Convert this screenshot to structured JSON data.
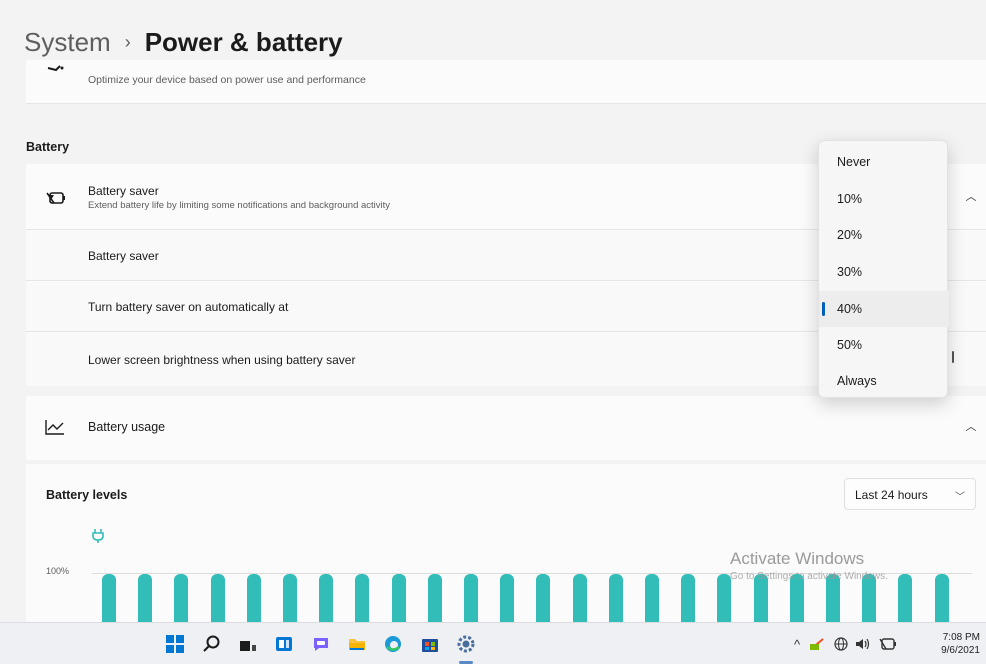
{
  "breadcrumb": {
    "parent": "System",
    "separator": "›",
    "current": "Power & battery"
  },
  "power_mode": {
    "description": "Optimize your device based on power use and performance"
  },
  "battery_section": {
    "label": "Battery"
  },
  "battery_saver": {
    "title": "Battery saver",
    "subtitle": "Extend battery life by limiting some notifications and background activity",
    "rows": [
      {
        "label": "Battery saver"
      },
      {
        "label": "Turn battery saver on automatically at"
      },
      {
        "label": "Lower screen brightness when using battery saver"
      }
    ]
  },
  "threshold_dropdown": {
    "options": [
      "Never",
      "10%",
      "20%",
      "30%",
      "40%",
      "50%",
      "Always"
    ],
    "selected": "40%"
  },
  "battery_usage": {
    "title": "Battery usage"
  },
  "battery_levels": {
    "title": "Battery levels",
    "range": "Last 24 hours",
    "axis_label": "100%",
    "bar_count": 24
  },
  "watermark": {
    "line1": "Activate Windows",
    "line2": "Go to Settings to activate Windows."
  },
  "taskbar": {
    "apps": [
      "windows-start",
      "search",
      "task-view",
      "widgets",
      "chat",
      "file-explorer",
      "edge",
      "store",
      "settings"
    ],
    "time": "7:08 PM",
    "date": "9/6/2021"
  },
  "colors": {
    "accent": "#005fb8",
    "bar": "#33bdb8"
  }
}
